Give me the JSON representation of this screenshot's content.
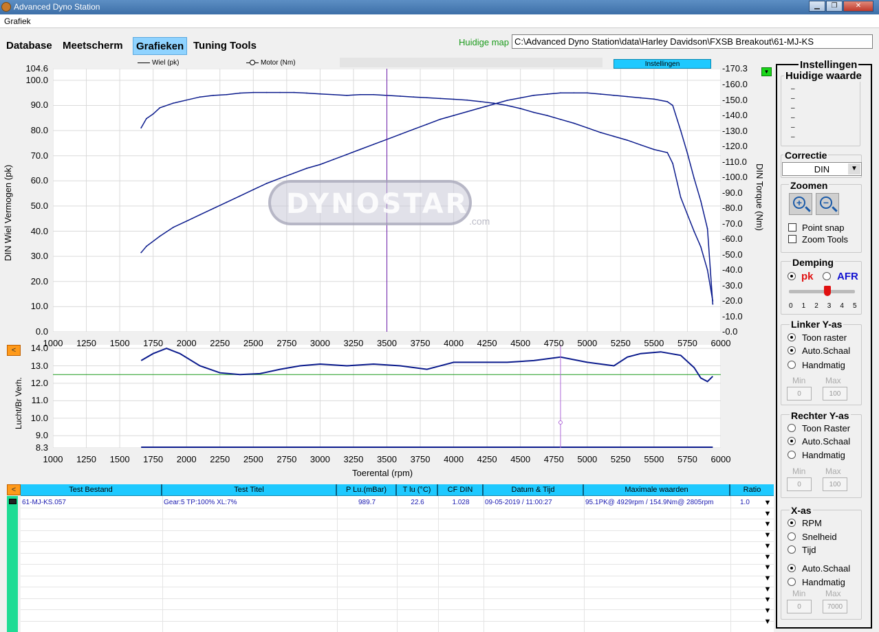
{
  "window": {
    "title": "Advanced Dyno Station",
    "min": "▁",
    "max": "❐",
    "close": "✕"
  },
  "menu": {
    "grafiek": "Grafiek"
  },
  "tabs": [
    "Database",
    "Meetscherm",
    "Grafieken",
    "Tuning Tools"
  ],
  "active_tab": "Grafieken",
  "map": {
    "label": "Huidige map",
    "path": "C:\\Advanced Dyno Station\\data\\Harley Davidson\\FXSB Breakout\\61-MJ-KS"
  },
  "legend": {
    "wheel": "Wiel (pk)",
    "motor": "Motor (Nm)"
  },
  "settings_button": "Instellingen",
  "watermark": "DYNOSTAR .com",
  "chart_data": [
    {
      "type": "line",
      "xlabel": "",
      "ylabel": "DIN Wiel Vermogen (pk)",
      "y2label": "DIN Torque (Nm)",
      "xlim": [
        1000,
        6000
      ],
      "ylim": [
        0,
        104.6
      ],
      "y2lim": [
        0,
        170.3
      ],
      "x_ticks": [
        "1000",
        "1250",
        "1500",
        "1750",
        "2000",
        "2250",
        "2500",
        "2750",
        "3000",
        "3250",
        "3500",
        "3750",
        "4000",
        "4250",
        "4500",
        "4750",
        "5000",
        "5250",
        "5500",
        "5750",
        "6000"
      ],
      "y_ticks": [
        "104.6",
        "100.0",
        "90.0",
        "80.0",
        "70.0",
        "60.0",
        "50.0",
        "40.0",
        "30.0",
        "20.0",
        "10.0",
        "0.0"
      ],
      "y2_ticks": [
        "-170.3",
        "-160.0",
        "-150.0",
        "-140.0",
        "-130.0",
        "-120.0",
        "-110.0",
        "-100.0",
        "-90.0",
        "-80.0",
        "-70.0",
        "-60.0",
        "-50.0",
        "-40.0",
        "-30.0",
        "-20.0",
        "-10.0",
        "-0.0"
      ],
      "grid": true,
      "cursor_rpm": 3500,
      "series": [
        {
          "name": "Wiel (pk)",
          "axis": "left",
          "color": "#0a1a8c",
          "x": [
            1660,
            1700,
            1800,
            1900,
            2000,
            2100,
            2200,
            2300,
            2400,
            2500,
            2600,
            2700,
            2800,
            2900,
            3000,
            3100,
            3200,
            3300,
            3400,
            3500,
            3600,
            3700,
            3800,
            3900,
            4000,
            4100,
            4200,
            4300,
            4400,
            4500,
            4600,
            4700,
            4800,
            4900,
            5000,
            5100,
            5200,
            5300,
            5400,
            5500,
            5600,
            5640,
            5700,
            5750,
            5800,
            5850,
            5900,
            5940
          ],
          "y": [
            31.5,
            34,
            38,
            41.5,
            44,
            46.5,
            49,
            51.5,
            54,
            56.5,
            59,
            61,
            63,
            65,
            66.5,
            68.5,
            70.5,
            72.5,
            74.5,
            76.5,
            78.5,
            80.5,
            82.5,
            84.5,
            86,
            87.5,
            89,
            90.5,
            92,
            93,
            94,
            94.5,
            95,
            95,
            95,
            94.5,
            94,
            93.5,
            93,
            92.5,
            91.5,
            90,
            80,
            71,
            61,
            52,
            41,
            11
          ]
        },
        {
          "name": "Motor (Nm)",
          "axis": "right",
          "color": "#0a1a8c",
          "x": [
            1660,
            1700,
            1750,
            1800,
            1900,
            2000,
            2100,
            2200,
            2300,
            2400,
            2500,
            2600,
            2700,
            2805,
            2900,
            3000,
            3100,
            3200,
            3300,
            3400,
            3500,
            3600,
            3700,
            3800,
            3900,
            4000,
            4100,
            4200,
            4300,
            4400,
            4500,
            4600,
            4700,
            4800,
            4900,
            5000,
            5100,
            5200,
            5300,
            5400,
            5500,
            5600,
            5640,
            5700,
            5750,
            5800,
            5850,
            5900,
            5940
          ],
          "y": [
            132,
            138,
            141,
            145,
            148,
            150,
            152,
            153,
            153.5,
            154.5,
            154.9,
            154.9,
            154.9,
            154.9,
            154.5,
            154,
            153.5,
            153,
            153.5,
            153.5,
            153,
            152.5,
            152,
            151.5,
            151,
            150.5,
            150,
            149,
            148,
            146.5,
            144.5,
            142,
            140,
            137.5,
            135,
            132,
            129,
            126.5,
            124,
            121,
            118,
            116,
            109,
            87,
            76,
            65,
            55,
            40,
            20
          ]
        }
      ]
    },
    {
      "type": "line",
      "xlabel": "Toerental (rpm)",
      "ylabel": "Lucht/Br Verh.",
      "xlim": [
        1000,
        6000
      ],
      "ylim": [
        8.3,
        14.2
      ],
      "x_ticks": [
        "1000",
        "1250",
        "1500",
        "1750",
        "2000",
        "2250",
        "2500",
        "2750",
        "3000",
        "3250",
        "3500",
        "3750",
        "4000",
        "4250",
        "4500",
        "4750",
        "5000",
        "5250",
        "5500",
        "5750",
        "6000"
      ],
      "y_ticks": [
        "14.0",
        "13.0",
        "12.0",
        "11.0",
        "10.0",
        "9.0",
        "8.3"
      ],
      "target_afr": 12.5,
      "cursor_rpm": 4800,
      "series": [
        {
          "name": "AFR",
          "color": "#0a1a8c",
          "x": [
            1660,
            1750,
            1850,
            1950,
            2100,
            2250,
            2400,
            2550,
            2700,
            2850,
            3000,
            3200,
            3400,
            3600,
            3800,
            4000,
            4200,
            4400,
            4600,
            4800,
            5000,
            5200,
            5300,
            5400,
            5550,
            5700,
            5800,
            5850,
            5900,
            5940
          ],
          "y": [
            13.3,
            13.7,
            14.0,
            13.7,
            13.0,
            12.6,
            12.5,
            12.55,
            12.8,
            13.0,
            13.1,
            13.0,
            13.1,
            13.0,
            12.8,
            13.2,
            13.2,
            13.2,
            13.3,
            13.5,
            13.2,
            13.0,
            13.5,
            13.7,
            13.8,
            13.6,
            12.9,
            12.3,
            12.1,
            12.4
          ]
        }
      ]
    }
  ],
  "table": {
    "headers": [
      "Test Bestand",
      "Test Titel",
      "P Lu.(mBar)",
      "T lu (°C)",
      "CF DIN",
      "Datum & Tijd",
      "Maximale waarden",
      "Ratio"
    ],
    "rows": [
      [
        "61-MJ-KS.057",
        "Gear:5 TP:100% XL:7%",
        "989.7",
        "22.6",
        "1.028",
        "09-05-2019 / 11:00:27",
        "95.1PK@ 4929rpm / 154.9Nm@ 2805rpm",
        "1.0"
      ]
    ]
  },
  "side_panel": {
    "title": "Instellingen",
    "current_values": "Huidige waarde",
    "value_markers": [
      "–",
      "–",
      "–",
      "–",
      "–",
      "–"
    ],
    "correctie": {
      "title": "Correctie",
      "value": "DIN"
    },
    "zoomen": {
      "title": "Zoomen",
      "point_snap": "Point snap",
      "zoom_tools": "Zoom Tools"
    },
    "demping": {
      "title": "Demping",
      "pk": "pk",
      "afr": "AFR",
      "scale": [
        "0",
        "1",
        "2",
        "3",
        "4",
        "5"
      ],
      "value": 3
    },
    "linker": {
      "title": "Linker Y-as",
      "toon": "Toon raster",
      "auto": "Auto.Schaal",
      "hand": "Handmatig",
      "min_label": "Min",
      "max_label": "Max",
      "min": "0",
      "max": "100"
    },
    "rechter": {
      "title": "Rechter Y-as",
      "toon": "Toon Raster",
      "auto": "Auto.Schaal",
      "hand": "Handmatig",
      "min_label": "Min",
      "max_label": "Max",
      "min": "0",
      "max": "100"
    },
    "xas": {
      "title": "X-as",
      "rpm": "RPM",
      "snelheid": "Snelheid",
      "tijd": "Tijd",
      "auto": "Auto.Schaal",
      "hand": "Handmatig",
      "min_label": "Min",
      "max_label": "Max",
      "min": "0",
      "max": "7000"
    }
  }
}
